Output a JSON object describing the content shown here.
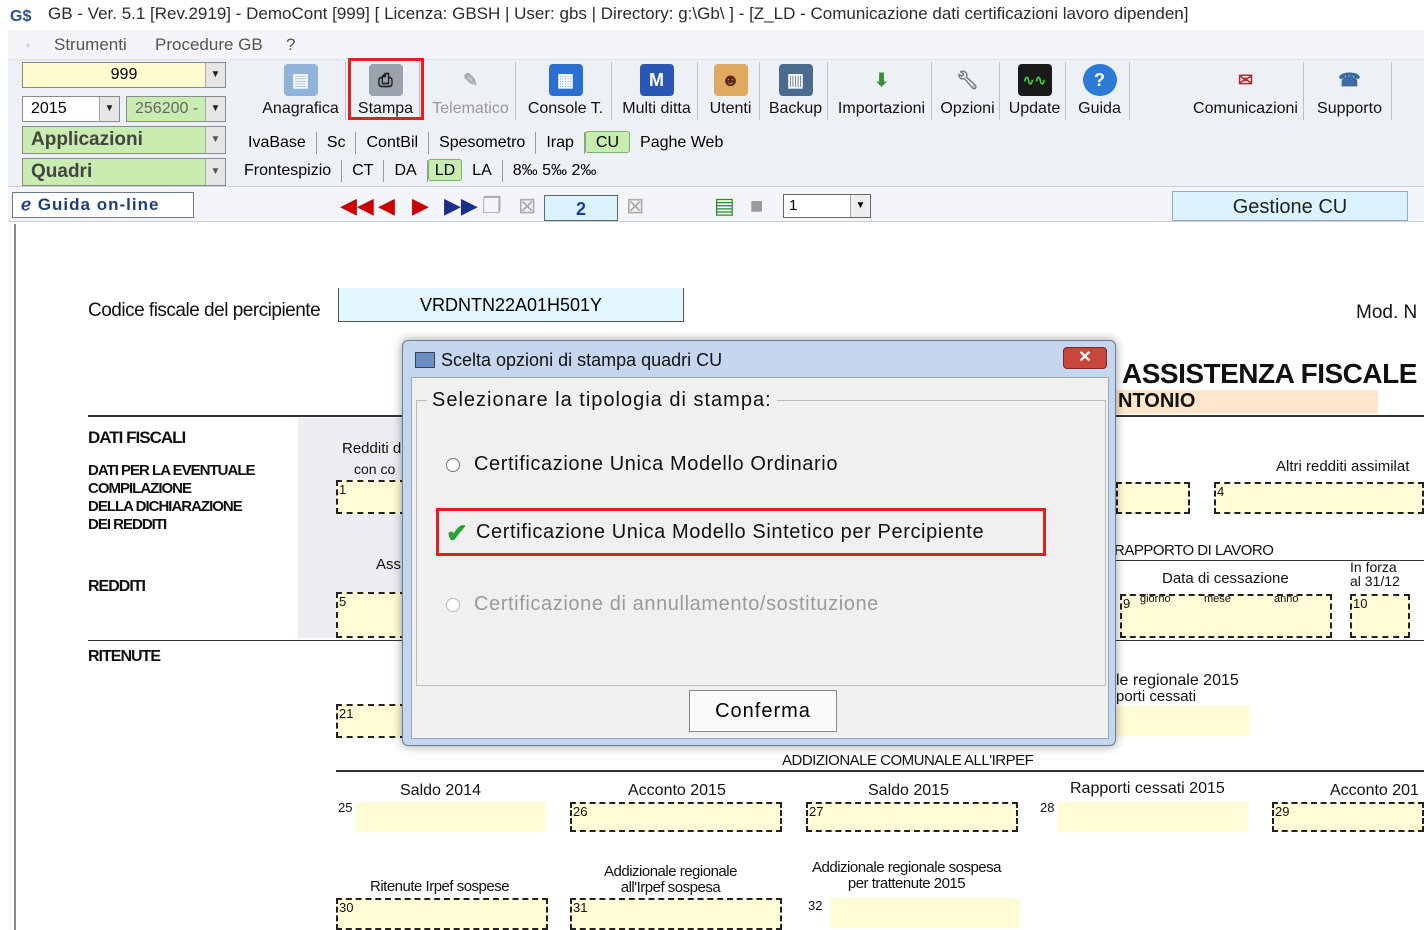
{
  "window": {
    "title": "GB - Ver. 5.1 [Rev.2919] -  DemoCont [999]     [ Licenza: GBSH | User: gbs | Directory: g:\\Gb\\ ] - [Z_LD - Comunicazione dati certificazioni  lavoro dipenden]"
  },
  "menu": [
    "Strumenti",
    "Procedure GB",
    "?"
  ],
  "left_panel": {
    "company_code": "999",
    "year": "2015",
    "account": "256200 -",
    "group1": "Applicazioni",
    "group2": "Quadri"
  },
  "toolbar": [
    {
      "label": "Anagrafica",
      "icon": "address-card-icon"
    },
    {
      "label": "Stampa",
      "icon": "printer-icon"
    },
    {
      "label": "Telematico",
      "icon": "telematic-icon"
    },
    {
      "label": "Console T.",
      "icon": "console-icon"
    },
    {
      "label": "Multi ditta",
      "icon": "multi-company-icon"
    },
    {
      "label": "Utenti",
      "icon": "users-icon"
    },
    {
      "label": "Backup",
      "icon": "backup-icon"
    },
    {
      "label": "Importazioni",
      "icon": "import-icon"
    },
    {
      "label": "Opzioni",
      "icon": "wrench-icon"
    },
    {
      "label": "Update",
      "icon": "update-icon"
    },
    {
      "label": "Guida",
      "icon": "help-icon"
    },
    {
      "label": "Comunicazioni",
      "icon": "communications-icon"
    },
    {
      "label": "Supporto",
      "icon": "support-icon"
    }
  ],
  "tabs_row1": [
    "IvaBase",
    "Sc",
    "ContBil",
    "Spesometro",
    "Irap",
    "CU",
    "Paghe Web"
  ],
  "tabs_row2": [
    "Frontespizio",
    "CT",
    "DA",
    "LD",
    "LA",
    "8‰  5‰  2‰"
  ],
  "navbar": {
    "guida": "Guida on-line",
    "page": "2",
    "zoom": "1",
    "gestione": "Gestione CU"
  },
  "form": {
    "cf_label": "Codice fiscale del percipiente",
    "cf_value": "VRDNTN22A01H501Y",
    "mod": "Mod. N",
    "assistenza": "ASSISTENZA FISCALE",
    "ntonio": "NTONIO",
    "dati_fiscali": "DATI FISCALI",
    "dati_eventuale": "DATI PER LA EVENTUALE\nCOMPILAZIONE\nDELLA DICHIARAZIONE\nDEI REDDITI",
    "redditi": "REDDITI",
    "ritenute": "RITENUTE",
    "redditi_di": "Redditi di",
    "con_co": "con co",
    "ass": "Ass",
    "altri_redditi": "Altri redditi assimilat",
    "rapporto": "RAPPORTO DI LAVORO",
    "data_cessazione": "Data di cessazione",
    "giorno": "giorno",
    "mese": "mese",
    "anno": "anno",
    "in_forza": "In forza\nal 31/12",
    "le_regionale": "le regionale 2015",
    "porti_cessati": "porti cessati",
    "addizionale_comunale": "ADDIZIONALE COMUNALE ALL'IRPEF",
    "saldo2014": "Saldo 2014",
    "acconto2015": "Acconto 2015",
    "saldo2015": "Saldo  2015",
    "rapporti_cessati": "Rapporti cessati 2015",
    "acconto201": "Acconto 201",
    "ritenute_sospese": "Ritenute Irpef sospese",
    "add_reg_sospesa": "Addizionale regionale\nall'Irpef sospesa",
    "add_reg_trattenute": "Addizionale regionale sospesa\nper trattenute 2015",
    "nums": {
      "n1": "1",
      "n4": "4",
      "n5": "5",
      "n9": "9",
      "n10": "10",
      "n21": "21",
      "n25": "25",
      "n26": "26",
      "n27": "27",
      "n28": "28",
      "n29": "29",
      "n30": "30",
      "n31": "31",
      "n32": "32"
    }
  },
  "dialog": {
    "title": "Scelta opzioni di stampa quadri CU",
    "group_label": "Selezionare la tipologia di stampa:",
    "options": [
      {
        "label": "Certificazione Unica Modello Ordinario",
        "selected": false,
        "enabled": true
      },
      {
        "label": "Certificazione Unica Modello Sintetico per Percipiente",
        "selected": true,
        "enabled": true
      },
      {
        "label": "Certificazione di annullamento/sostituzione",
        "selected": false,
        "enabled": false
      }
    ],
    "confirm": "Conferma"
  },
  "colors": {
    "highlight": "#e02020",
    "active_tab": "#c9ecb1",
    "field_bg": "#fffbd6",
    "dialog_frame": "#c4d7ee"
  }
}
